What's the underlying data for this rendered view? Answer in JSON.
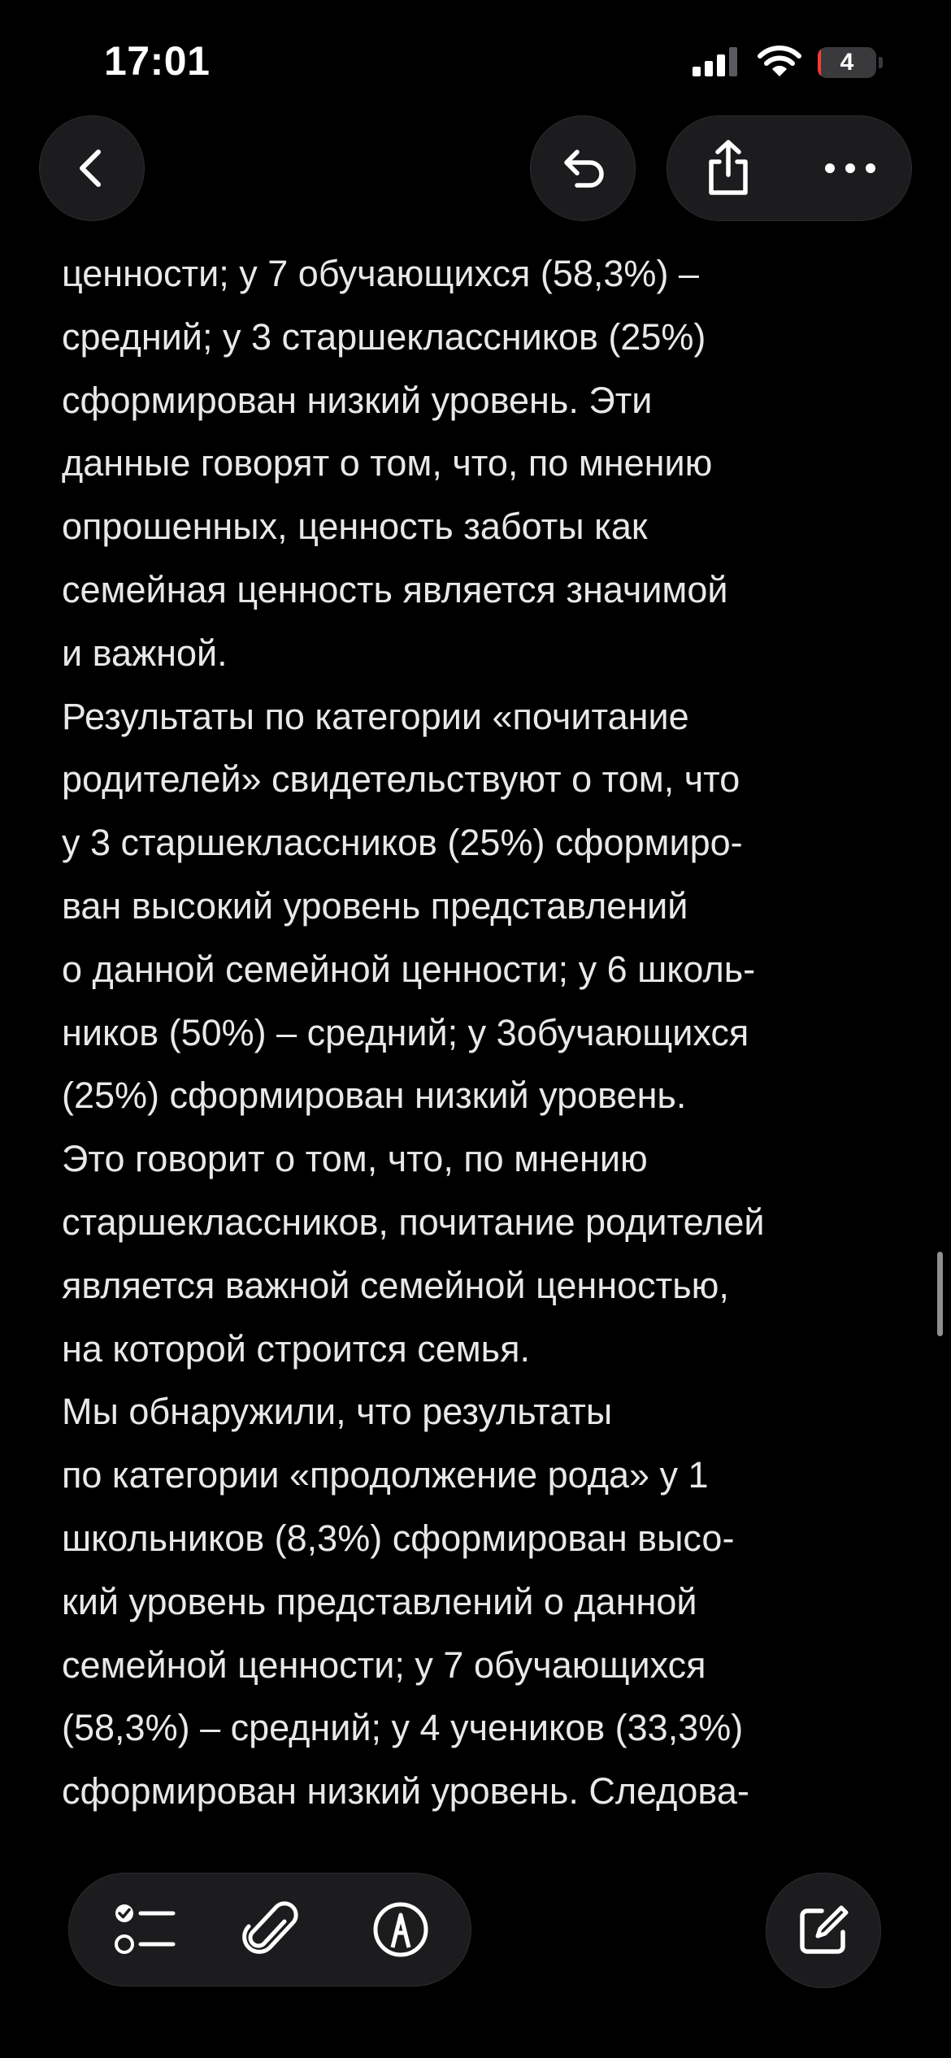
{
  "status_bar": {
    "time": "17:01",
    "battery_level": "4",
    "battery_fraction": 0.04,
    "icons": [
      "cellular-signal-icon",
      "wifi-icon",
      "battery-icon"
    ]
  },
  "nav": {
    "icons": [
      "chevron-left-icon",
      "undo-icon",
      "share-icon",
      "ellipsis-icon"
    ]
  },
  "note": {
    "lines": [
      "ценности; у 7 обучающихся (58,3%) –",
      "средний; у 3 старшеклассников (25%)",
      "сформирован низкий уровень. Эти",
      "данные говорят о том, что, по мнению",
      "опрошенных, ценность заботы как",
      "семейная ценность является значимой",
      "и важной.",
      "Результаты по категории «почитание",
      "родителей» свидетельствуют о том, что",
      "у 3 старшеклассников (25%) сформиро-",
      "ван высокий уровень представлений",
      "о данной семейной ценности; у 6 школь-",
      "ников (50%) – средний; у 3обучающихся",
      "(25%) сформирован низкий уровень.",
      "Это говорит о том, что, по мнению",
      "старшеклассников, почитание родителей",
      "является важной семейной ценностью,",
      "на которой строится семья.",
      "Мы обнаружили, что результаты",
      "по категории «продолжение рода» у 1",
      "школьников (8,3%) сформирован высо-",
      "кий уровень представлений о данной",
      "семейной ценности; у 7 обучающихся",
      "(58,3%) – средний; у 4 учеников (33,3%)",
      "сформирован низкий уровень. Следова-"
    ]
  },
  "toolbar": {
    "icons": [
      "checklist-icon",
      "paperclip-icon",
      "markup-pen-icon",
      "compose-icon"
    ]
  },
  "colors": {
    "background": "#000000",
    "text": "#e8e8e8",
    "button_fill": "#1c1c1e",
    "battery_low": "#ff3b30"
  }
}
